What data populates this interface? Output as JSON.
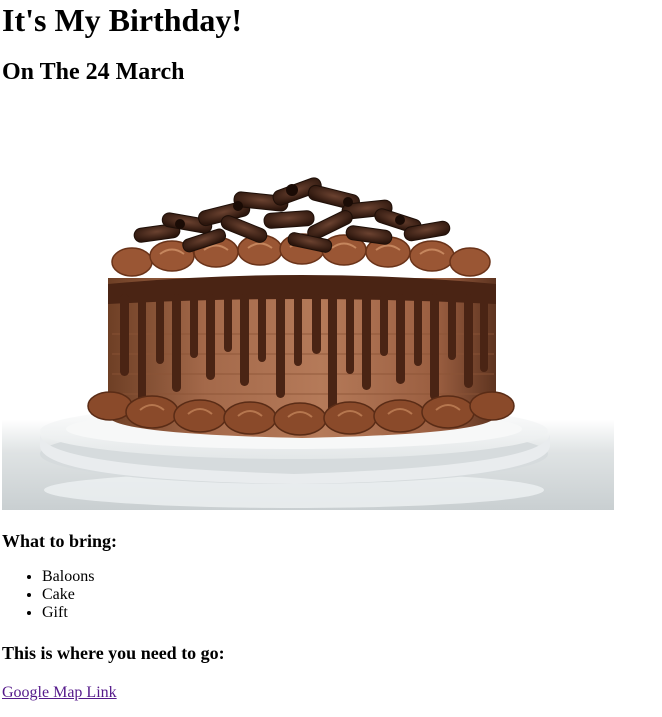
{
  "page": {
    "title": "It's My Birthday!",
    "date_heading": "On The 24 March"
  },
  "image": {
    "alt": "chocolate-cake"
  },
  "bring": {
    "heading": "What to bring:",
    "items": [
      "Baloons",
      "Cake",
      "Gift"
    ]
  },
  "location": {
    "heading": "This is where you need to go:",
    "link_label": "Google Map Link"
  }
}
